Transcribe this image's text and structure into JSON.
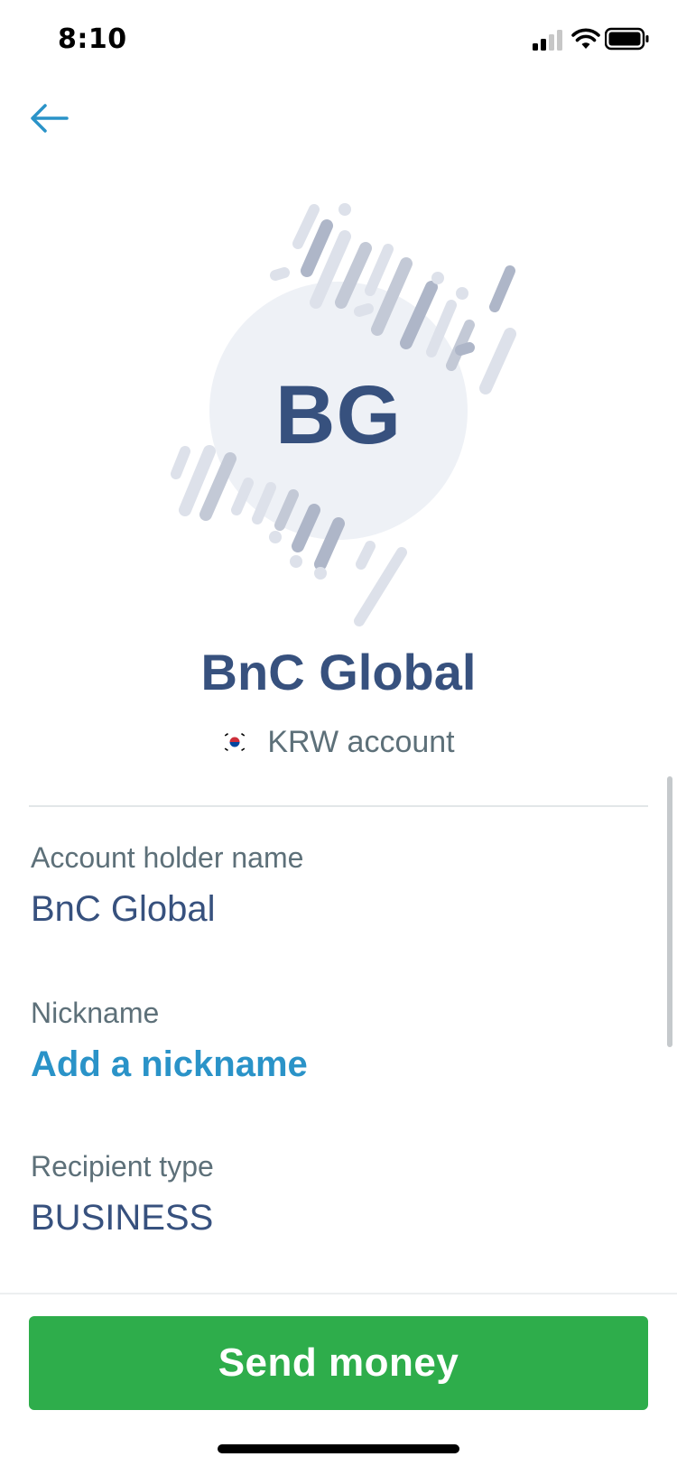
{
  "status_bar": {
    "time": "8:10",
    "icons": [
      "cellular-signal-icon",
      "wifi-icon",
      "battery-icon"
    ]
  },
  "header": {
    "back_icon": "arrow-left-icon"
  },
  "avatar": {
    "initials": "BG"
  },
  "recipient": {
    "name": "BnC Global",
    "flag_icon": "south-korea-flag-icon",
    "account_type": "KRW account"
  },
  "details": {
    "account_holder": {
      "label": "Account holder name",
      "value": "BnC Global"
    },
    "nickname": {
      "label": "Nickname",
      "action": "Add a nickname"
    },
    "recipient_type": {
      "label": "Recipient type",
      "value": "BUSINESS"
    }
  },
  "footer": {
    "send_label": "Send money"
  },
  "colors": {
    "primary_text": "#37517e",
    "secondary_text": "#5d7079",
    "link": "#2a93c8",
    "accent_green": "#2ead4b"
  }
}
